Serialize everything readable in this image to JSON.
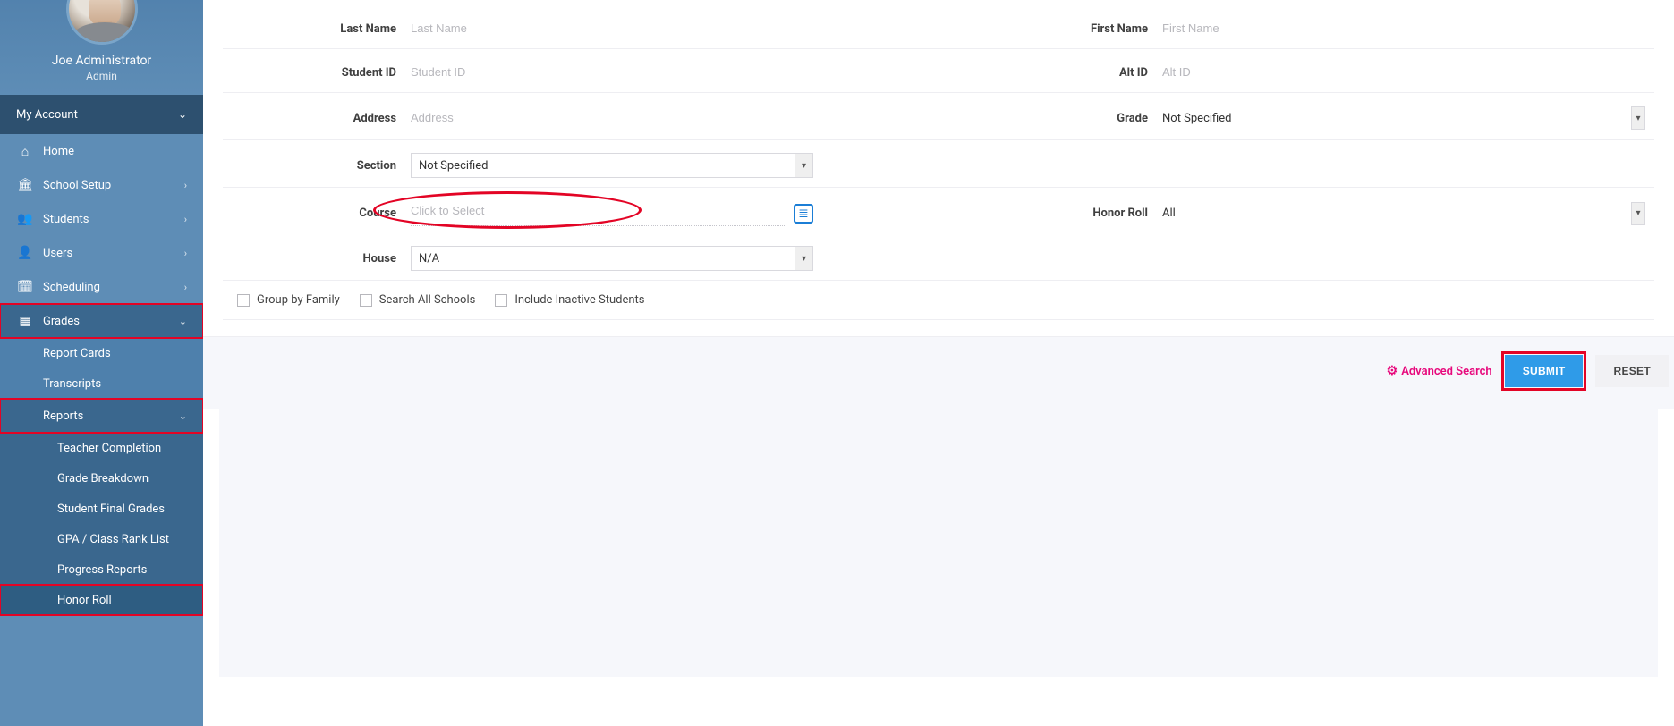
{
  "profile": {
    "name": "Joe Administrator",
    "role": "Admin"
  },
  "account": {
    "label": "My Account"
  },
  "nav": {
    "home": "Home",
    "school_setup": "School Setup",
    "students": "Students",
    "users": "Users",
    "scheduling": "Scheduling",
    "grades": "Grades"
  },
  "grades_sub": {
    "report_cards": "Report Cards",
    "transcripts": "Transcripts",
    "reports": "Reports"
  },
  "reports_sub": {
    "teacher_completion": "Teacher Completion",
    "grade_breakdown": "Grade Breakdown",
    "student_final_grades": "Student Final Grades",
    "gpa_class_rank": "GPA / Class Rank List",
    "progress_reports": "Progress Reports",
    "honor_roll": "Honor Roll"
  },
  "form": {
    "last_name": {
      "label": "Last Name",
      "placeholder": "Last Name"
    },
    "first_name": {
      "label": "First Name",
      "placeholder": "First Name"
    },
    "student_id": {
      "label": "Student ID",
      "placeholder": "Student ID"
    },
    "alt_id": {
      "label": "Alt ID",
      "placeholder": "Alt ID"
    },
    "address": {
      "label": "Address",
      "placeholder": "Address"
    },
    "grade": {
      "label": "Grade",
      "value": "Not Specified"
    },
    "section": {
      "label": "Section",
      "value": "Not Specified"
    },
    "course": {
      "label": "Course",
      "placeholder": "Click to Select"
    },
    "honor_roll": {
      "label": "Honor Roll",
      "value": "All"
    },
    "house": {
      "label": "House",
      "value": "N/A"
    }
  },
  "checks": {
    "group_family": "Group by Family",
    "search_all": "Search All Schools",
    "include_inactive": "Include Inactive Students"
  },
  "actions": {
    "advanced": "Advanced Search",
    "submit": "SUBMIT",
    "reset": "RESET"
  }
}
